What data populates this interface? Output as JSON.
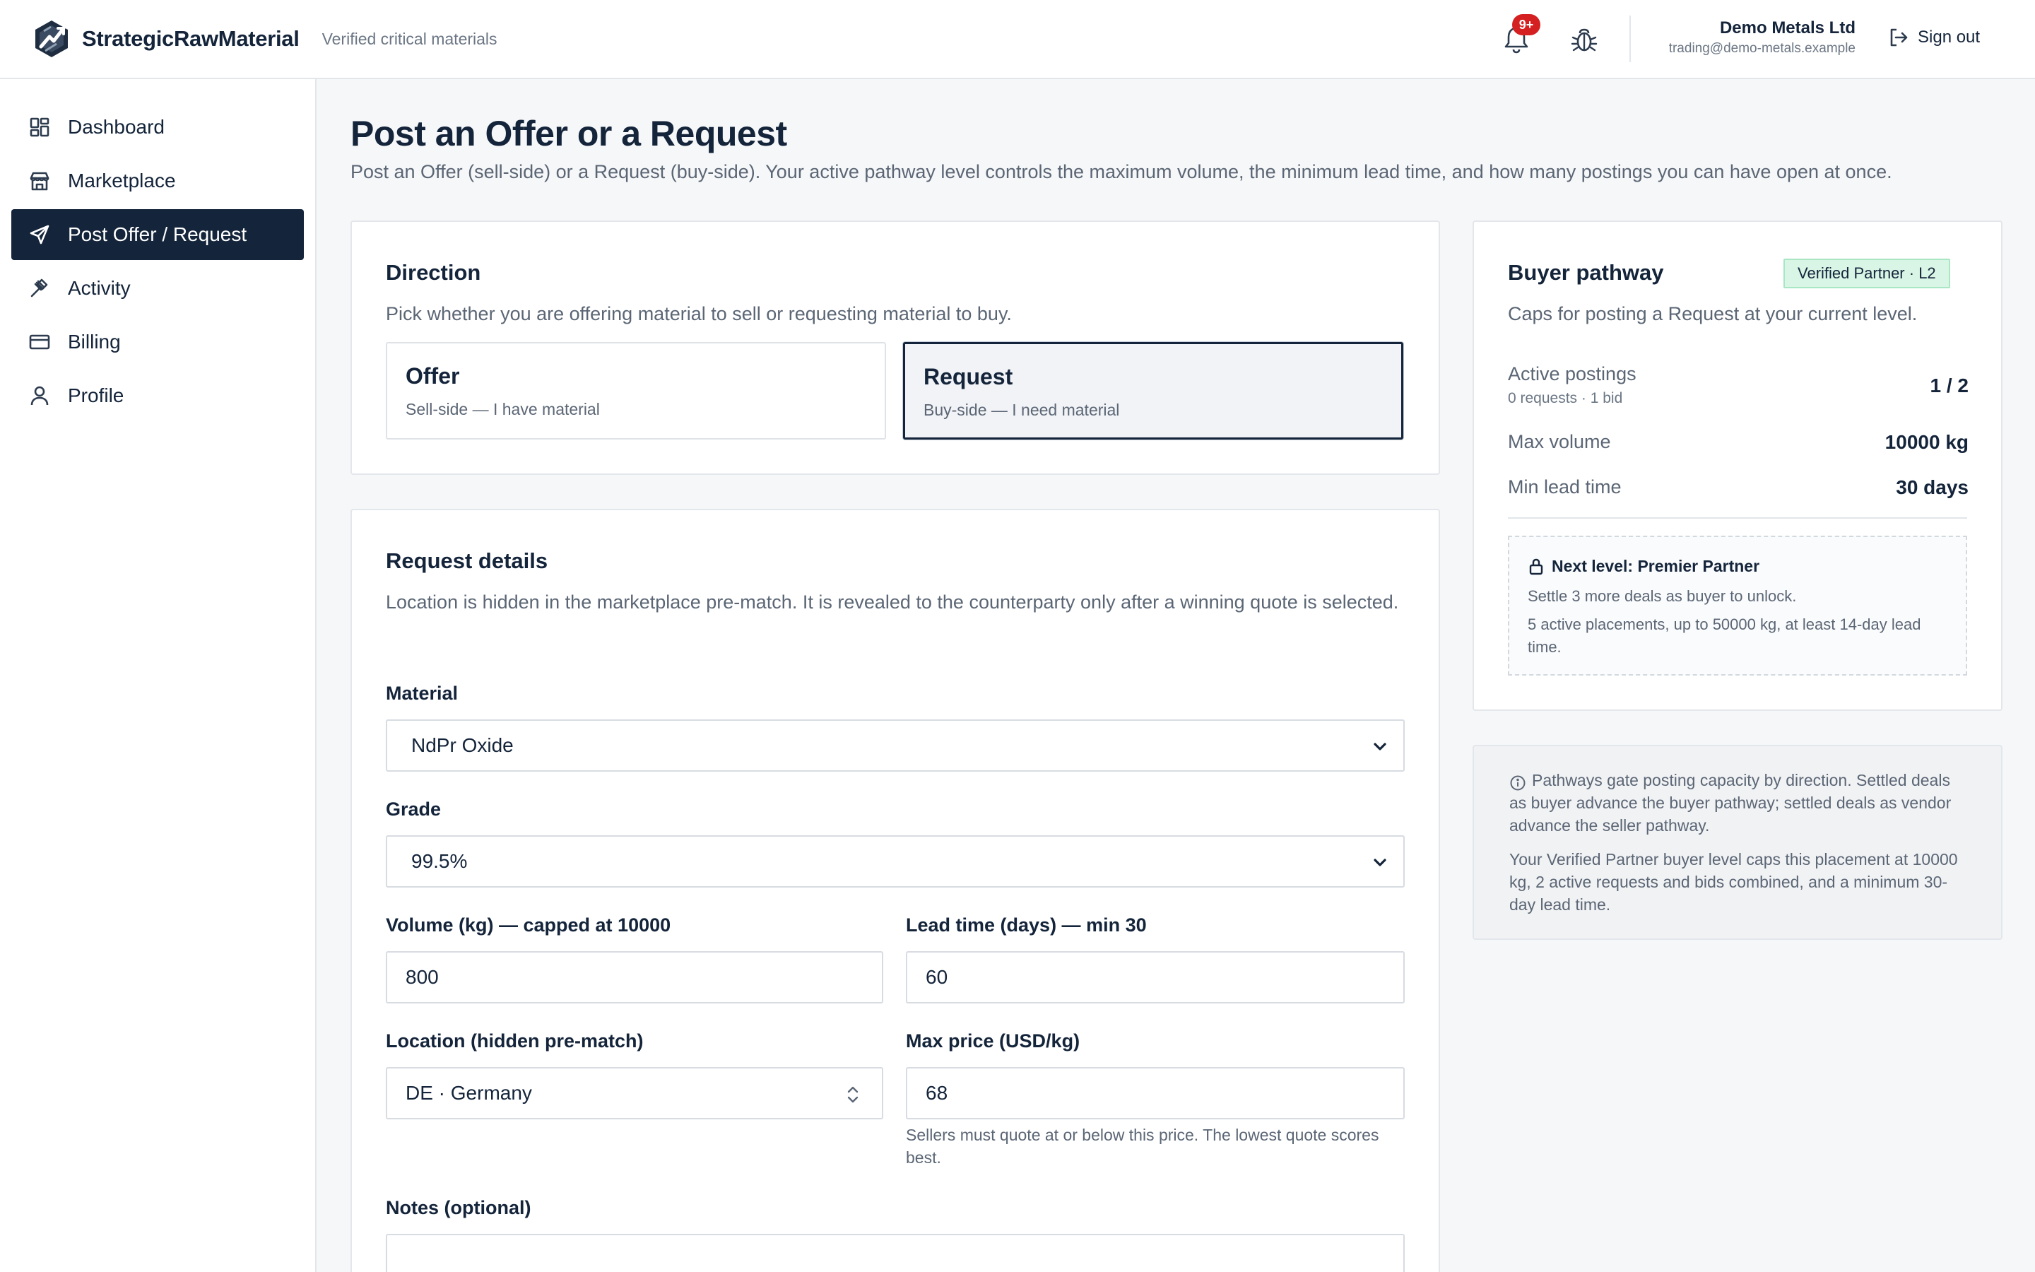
{
  "app": {
    "brand": "StrategicRawMaterial",
    "tagline": "Verified critical materials",
    "notification_badge": "9+",
    "account_name": "Demo Metals Ltd",
    "account_email": "trading@demo-metals.example",
    "sign_out": "Sign out"
  },
  "sidebar": {
    "items": [
      {
        "label": "Dashboard",
        "icon": "dashboard-icon"
      },
      {
        "label": "Marketplace",
        "icon": "store-icon"
      },
      {
        "label": "Post Offer / Request",
        "icon": "send-icon",
        "active": true
      },
      {
        "label": "Activity",
        "icon": "gavel-icon"
      },
      {
        "label": "Billing",
        "icon": "credit-card-icon"
      },
      {
        "label": "Profile",
        "icon": "user-icon"
      }
    ]
  },
  "page": {
    "title": "Post an Offer or a Request",
    "subtitle": "Post an Offer (sell-side) or a Request (buy-side). Your active pathway level controls the maximum volume, the minimum lead time, and how many postings you can have open at once."
  },
  "direction": {
    "title": "Direction",
    "subtitle": "Pick whether you are offering material to sell or requesting material to buy.",
    "offer": {
      "title": "Offer",
      "subtitle": "Sell-side — I have material"
    },
    "request": {
      "title": "Request",
      "subtitle": "Buy-side — I need material"
    },
    "selected": "request"
  },
  "details": {
    "title": "Request details",
    "subtitle": "Location is hidden in the marketplace pre-match. It is revealed to the counterparty only after a winning quote is selected.",
    "material_label": "Material",
    "material_value": "NdPr Oxide",
    "grade_label": "Grade",
    "grade_value": "99.5%",
    "volume_label": "Volume (kg) — capped at 10000",
    "volume_value": "800",
    "lead_label": "Lead time (days) — min 30",
    "lead_value": "60",
    "location_label": "Location (hidden pre-match)",
    "location_value": "DE · Germany",
    "price_label": "Max price (USD/kg)",
    "price_value": "68",
    "price_help": "Sellers must quote at or below this price. The lowest quote scores best.",
    "notes_label": "Notes (optional)"
  },
  "pathway": {
    "title": "Buyer pathway",
    "badge": "Verified Partner · L2",
    "subtitle": "Caps for posting a Request at your current level.",
    "active_label": "Active postings",
    "active_sub": "0 requests · 1 bid",
    "active_value": "1 / 2",
    "volume_label": "Max volume",
    "volume_value": "10000 kg",
    "lead_label": "Min lead time",
    "lead_value": "30 days",
    "next_title": "Next level: Premier Partner",
    "next_line1": "Settle 3 more deals as buyer to unlock.",
    "next_line2": "5 active placements, up to 50000 kg, at least 14-day lead time."
  },
  "info": {
    "paragraph1": "Pathways gate posting capacity by direction. Settled deals as buyer advance the buyer pathway; settled deals as vendor advance the seller pathway.",
    "paragraph2": "Your Verified Partner buyer level caps this placement at 10000 kg, 2 active requests and bids combined, and a minimum 30-day lead time."
  },
  "colors": {
    "navy": "#14243a",
    "badge_red": "#d42020",
    "badge_green_bg": "#d9f5e6"
  }
}
